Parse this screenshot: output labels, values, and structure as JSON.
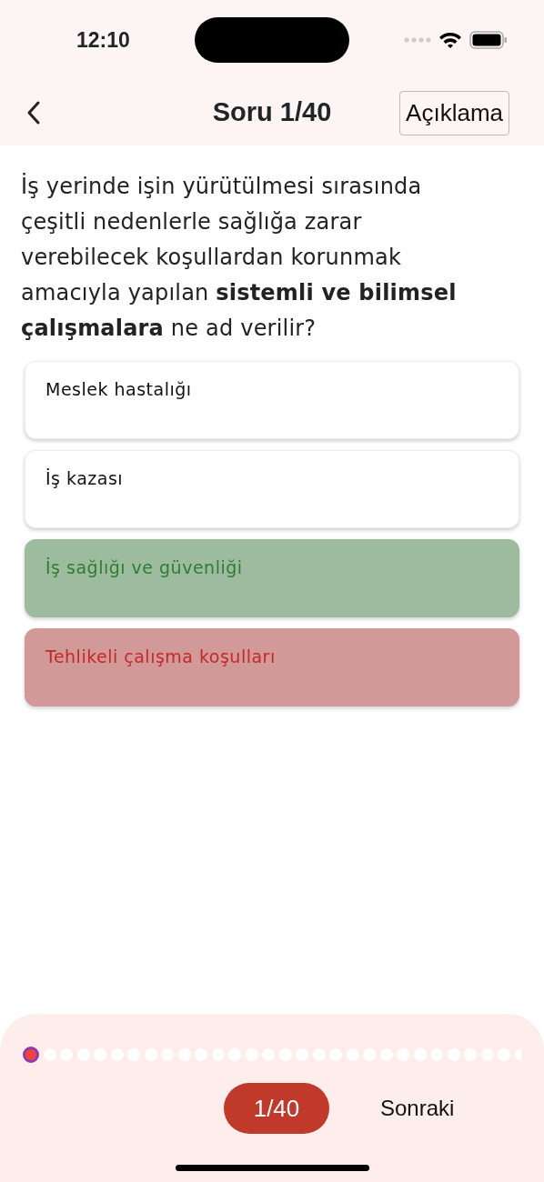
{
  "status_bar": {
    "time": "12:10"
  },
  "header": {
    "title": "Soru 1/40",
    "explain_button": "Açıklama"
  },
  "question": "İş yerinde işin yürütülmesi sırasında çeşitli nedenlerle sağlığa zarar verebilecek koşullardan korunmak amacıyla yapılan **sistemli ve bilimsel çalışmalara** ne ad verilir?",
  "options": [
    {
      "label": "Meslek hastalığı",
      "kind": "plain"
    },
    {
      "label": "İş kazası",
      "kind": "plain"
    },
    {
      "label": "İş sağlığı ve güvenliği",
      "kind": "correct"
    },
    {
      "label": "Tehlikeli çalışma koşulları",
      "kind": "wrong"
    }
  ],
  "progress_dots": [
    {
      "selected": true
    },
    {
      "selected": false
    },
    {
      "selected": false
    },
    {
      "selected": false
    },
    {
      "selected": false
    },
    {
      "selected": false
    },
    {
      "selected": false
    },
    {
      "selected": false
    },
    {
      "selected": false
    },
    {
      "selected": false
    },
    {
      "selected": false
    },
    {
      "selected": false
    },
    {
      "selected": false
    },
    {
      "selected": false
    },
    {
      "selected": false
    },
    {
      "selected": false
    },
    {
      "selected": false
    },
    {
      "selected": false
    },
    {
      "selected": false
    },
    {
      "selected": false
    },
    {
      "selected": false
    },
    {
      "selected": false
    },
    {
      "selected": false
    },
    {
      "selected": false
    },
    {
      "selected": false
    },
    {
      "selected": false
    },
    {
      "selected": false
    },
    {
      "selected": false
    },
    {
      "selected": false
    },
    {
      "selected": false
    }
  ],
  "footer": {
    "counter": "1/40",
    "next_button": "Sonraki"
  }
}
